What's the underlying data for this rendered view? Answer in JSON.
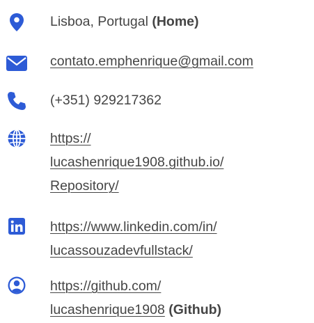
{
  "accent_color": "#2d5bd6",
  "text_color": "#454545",
  "contacts": [
    {
      "icon": "map-pin-icon",
      "text": "Lisboa, Portugal",
      "suffix": "(Home)"
    },
    {
      "icon": "envelope-icon",
      "link_text": "contato.emphenrique@gmail.com"
    },
    {
      "icon": "phone-icon",
      "text": "(+351) 929217362"
    },
    {
      "icon": "globe-icon",
      "link_lines": [
        "https://",
        "lucashenrique1908.github.io/",
        "Repository/"
      ]
    },
    {
      "icon": "linkedin-icon",
      "link_lines": [
        "https://www.linkedin.com/in/",
        "lucassouzadevfullstack/"
      ]
    },
    {
      "icon": "user-circle-icon",
      "link_lines": [
        "https://github.com/",
        "lucashenrique1908"
      ],
      "suffix": "(Github)"
    }
  ]
}
